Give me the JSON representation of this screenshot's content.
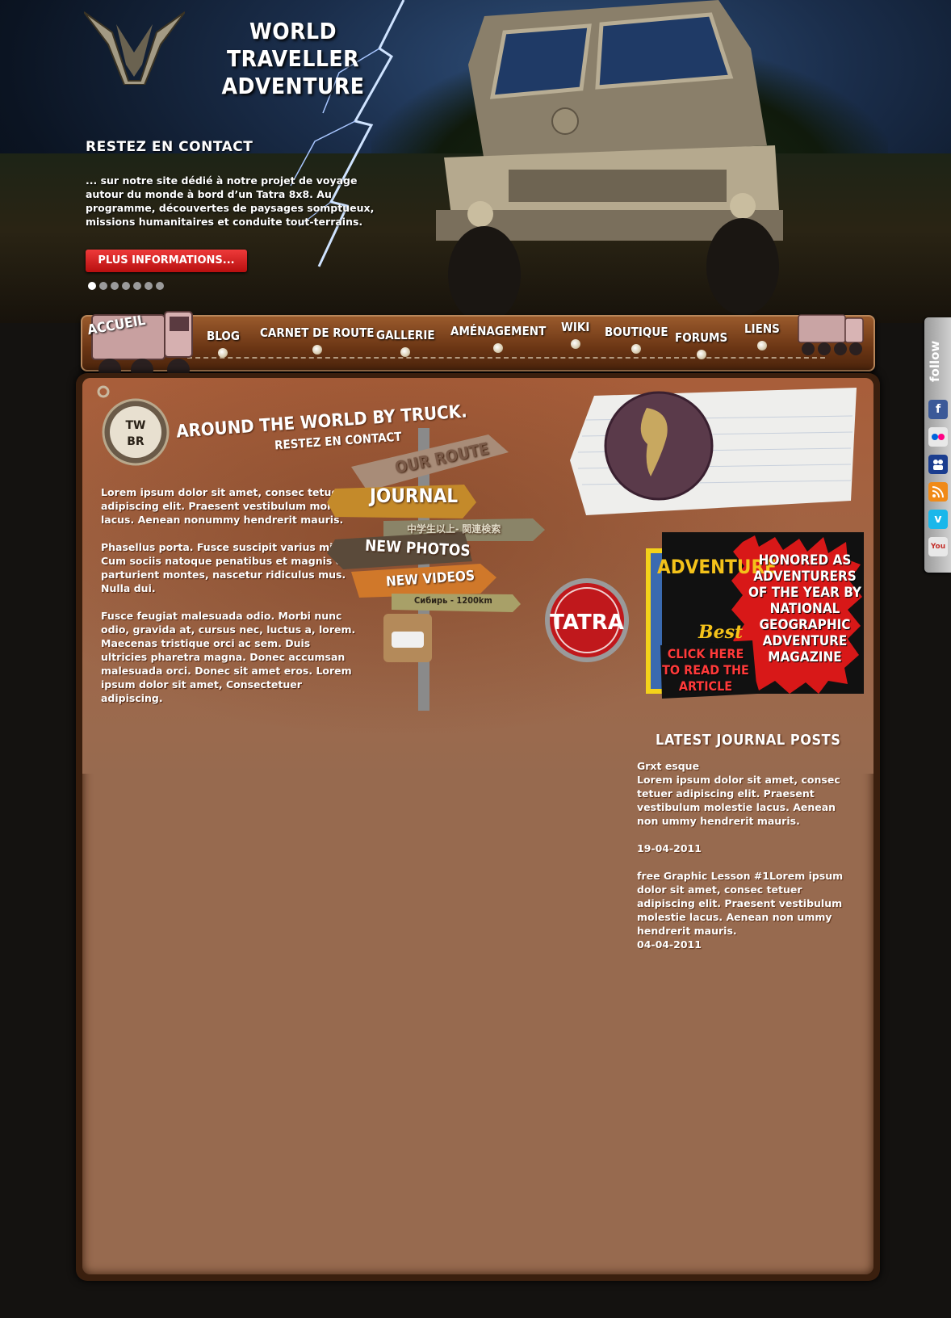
{
  "brand": {
    "line1": "WORLD TRAVELLER",
    "line2": "ADVENTURE",
    "logo_icon": "winged-w-logo-icon"
  },
  "hero": {
    "heading": "RESTEZ EN CONTACT",
    "text": "... sur notre site dédié à notre projet de voyage autour du monde à bord d’un Tatra 8x8. Au programme, découvertes de paysages somptueux, missions humanitaires et conduite tout-terrains.",
    "button": "PLUS INFORMATIONS...",
    "slides": 7,
    "active_slide": 1
  },
  "nav": {
    "items": [
      "ACCUEIL",
      "BLOG",
      "CARNET DE ROUTE",
      "GALLERIE",
      "AMÉNAGEMENT",
      "WIKI",
      "BOUTIQUE",
      "FORUMS",
      "LIENS"
    ]
  },
  "follow": {
    "label": "follow",
    "icons": [
      "facebook-icon",
      "flickr-icon",
      "myspace-icon",
      "rss-icon",
      "vimeo-icon",
      "youtube-icon"
    ]
  },
  "intro": {
    "tagline": "AROUND THE WORLD BY TRUCK.",
    "subtagline": "RESTEZ EN CONTACT",
    "badge": "TW BR",
    "paragraphs": [
      "Lorem ipsum dolor sit amet, consec tetuer adipiscing elit. Praesent vestibulum molestie lacus. Aenean nonummy hendrerit mauris.",
      "Phasellus porta. Fusce suscipit varius mi. Cum sociis natoque penatibus et magnis dis parturient montes, nascetur ridiculus mus. Nulla dui.",
      "Fusce feugiat malesuada odio. Morbi nunc odio, gravida at, cursus nec, luctus a, lorem. Maecenas tristique orci ac sem. Duis ultricies pharetra magna. Donec accumsan malesuada orci. Donec sit amet eros. Lorem ipsum dolor sit amet, Consectetuer adipiscing."
    ]
  },
  "signpost": {
    "our_route": "OUR ROUTE",
    "journal": "JOURNAL",
    "chinese": "中学生以上- 関連検索",
    "new_photos": "NEW PHOTOS",
    "new_videos": "NEW VIDEOS",
    "siberia": "Сибирь - 1200km"
  },
  "tatra_badge": "TATRA",
  "magazine": {
    "title": "ADVENTURE",
    "best": "Best",
    "honor": "HONORED AS ADVENTURERS OF THE YEAR BY NATIONAL GEOGRAPHIC ADVENTURE MAGAZINE",
    "click": "CLICK HERE TO READ THE ARTICLE"
  },
  "latest": {
    "title": "LATEST JOURNAL POSTS",
    "posts": [
      {
        "title": "Grxt esque",
        "body": "Lorem ipsum dolor sit amet, consec tetuer adipiscing elit. Praesent vestibulum molestie lacus. Aenean non ummy hendrerit mauris.",
        "date": "19-04-2011"
      },
      {
        "title": "free Graphic Lesson #1",
        "body": "Lorem ipsum dolor sit amet, consec tetuer adipiscing elit. Praesent vestibulum molestie lacus. Aenean non ummy hendrerit mauris.",
        "date": "04-04-2011"
      }
    ]
  }
}
